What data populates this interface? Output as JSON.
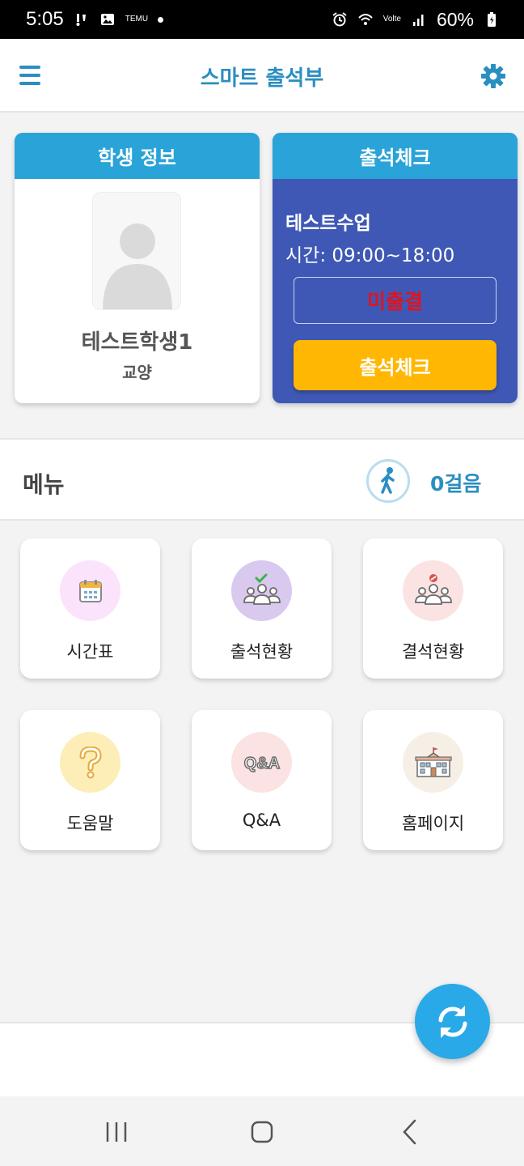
{
  "status_bar": {
    "time": "5:05",
    "notif_label": "TEMU",
    "network": "Volte",
    "battery": "60%",
    "icons": [
      "missed-call-icon",
      "image-icon",
      "temu-icon",
      "dot-icon",
      "alarm-icon",
      "wifi-icon",
      "signal-icon",
      "battery-icon"
    ]
  },
  "header": {
    "title": "스마트 출석부",
    "icons": {
      "menu": "hamburger-icon",
      "settings": "gear-icon"
    }
  },
  "student": {
    "header": "학생 정보",
    "name": "테스트학생1",
    "dept": "교양"
  },
  "attendance": {
    "header": "출석체크",
    "class_name": "테스트수업",
    "time": "시간: 09:00~18:00",
    "status": "미출결",
    "button": "출석체크"
  },
  "menu": {
    "label": "메뉴",
    "steps": "0걸음",
    "tiles": [
      {
        "label": "시간표",
        "icon": "calendar-icon",
        "bg": "#fbe3fb"
      },
      {
        "label": "출석현황",
        "icon": "attendance-group-icon",
        "bg": "#d9c9ef"
      },
      {
        "label": "결석현황",
        "icon": "absence-group-icon",
        "bg": "#fbe3e3"
      },
      {
        "label": "도움말",
        "icon": "question-icon",
        "bg": "#fdedb7"
      },
      {
        "label": "Q&A",
        "icon": "qna-icon",
        "bg": "#fbe3e3"
      },
      {
        "label": "홈페이지",
        "icon": "school-building-icon",
        "bg": "#f6efe6"
      }
    ]
  },
  "colors": {
    "accent": "#2b8ec0",
    "card_header": "#29a3d8",
    "attend_bg": "#3f58b5",
    "status_red": "#e0141e",
    "button_yellow": "#ffb703",
    "fab": "#29a9e8"
  },
  "fab_icon": "refresh-icon",
  "nav": {
    "icons": [
      "recent-apps-icon",
      "home-icon",
      "back-icon"
    ]
  }
}
